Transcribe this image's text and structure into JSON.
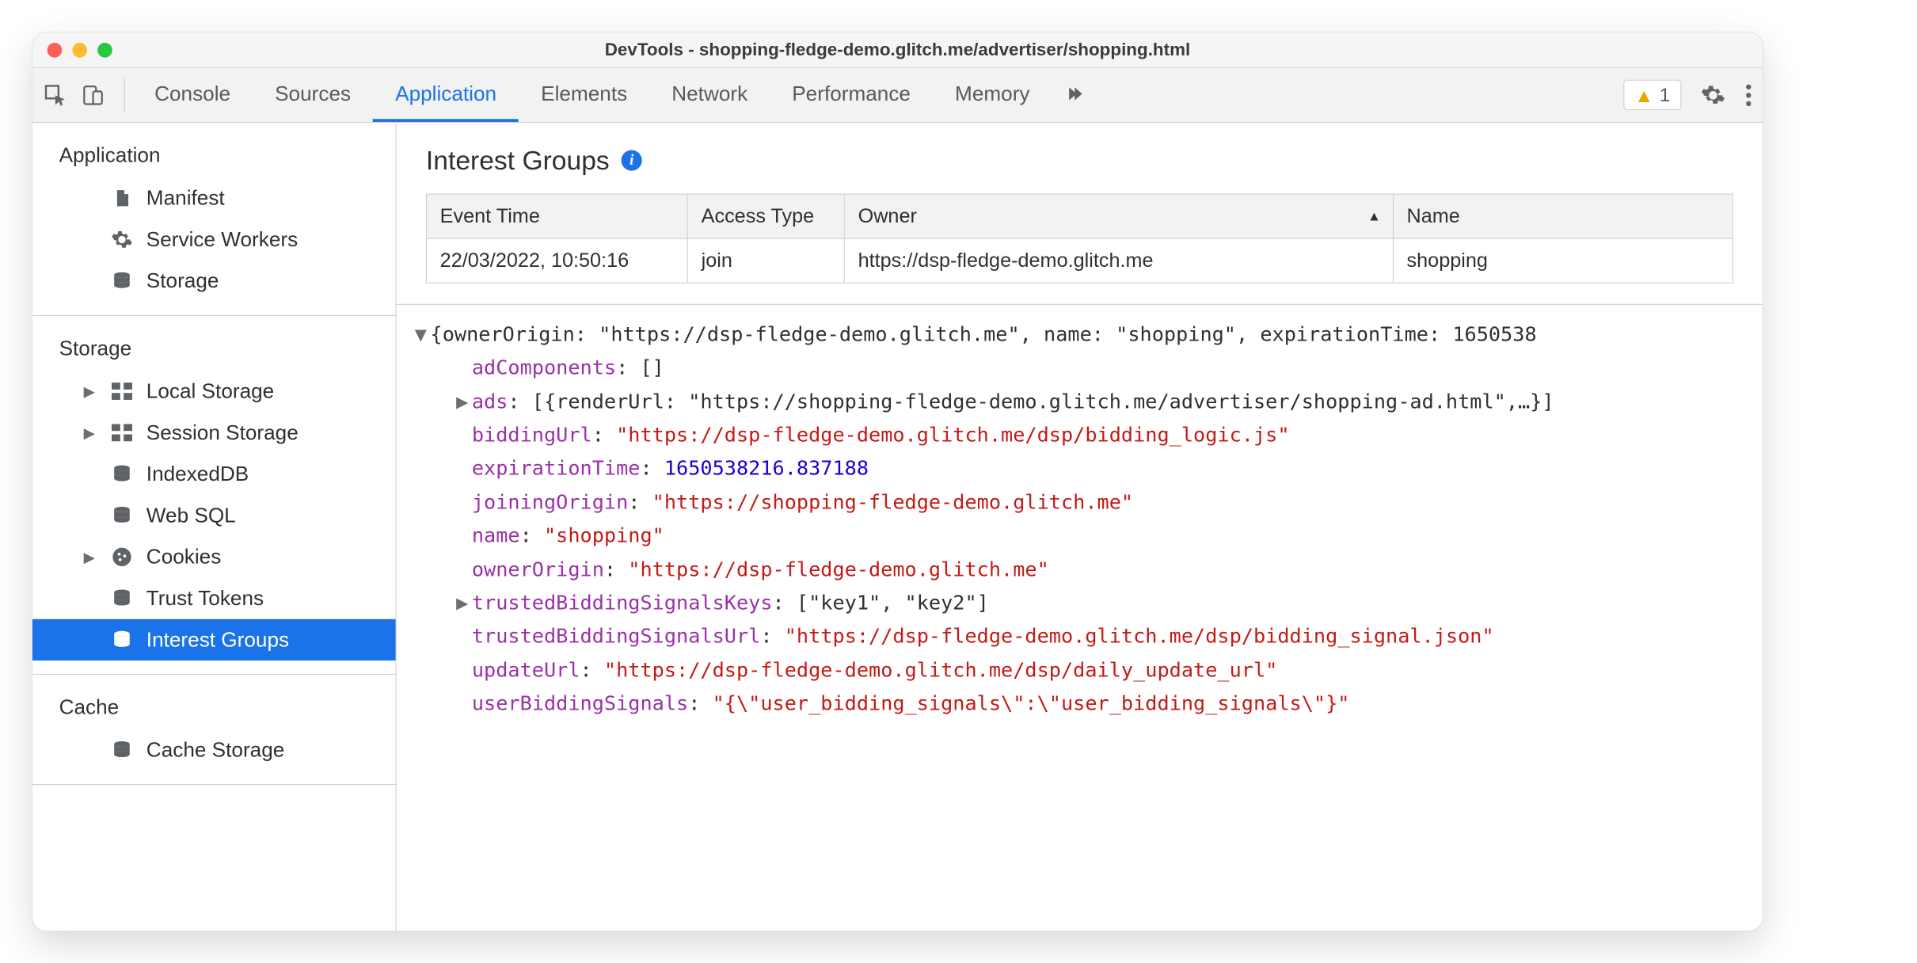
{
  "window": {
    "title": "DevTools - shopping-fledge-demo.glitch.me/advertiser/shopping.html"
  },
  "toolbar": {
    "tabs": [
      "Console",
      "Sources",
      "Application",
      "Elements",
      "Network",
      "Performance",
      "Memory"
    ],
    "active_tab_index": 2,
    "warning_count": "1"
  },
  "sidebar": {
    "sections": [
      {
        "title": "Application",
        "items": [
          {
            "label": "Manifest",
            "icon": "doc",
            "expandable": false
          },
          {
            "label": "Service Workers",
            "icon": "gear",
            "expandable": false
          },
          {
            "label": "Storage",
            "icon": "db",
            "expandable": false
          }
        ]
      },
      {
        "title": "Storage",
        "items": [
          {
            "label": "Local Storage",
            "icon": "grid",
            "expandable": true
          },
          {
            "label": "Session Storage",
            "icon": "grid",
            "expandable": true
          },
          {
            "label": "IndexedDB",
            "icon": "db",
            "expandable": false
          },
          {
            "label": "Web SQL",
            "icon": "db",
            "expandable": false
          },
          {
            "label": "Cookies",
            "icon": "cookie",
            "expandable": true
          },
          {
            "label": "Trust Tokens",
            "icon": "db",
            "expandable": false
          },
          {
            "label": "Interest Groups",
            "icon": "db",
            "expandable": false,
            "selected": true
          }
        ]
      },
      {
        "title": "Cache",
        "items": [
          {
            "label": "Cache Storage",
            "icon": "db",
            "expandable": false
          }
        ]
      }
    ]
  },
  "main": {
    "heading": "Interest Groups",
    "table": {
      "headers": [
        "Event Time",
        "Access Type",
        "Owner",
        "Name"
      ],
      "sort_col_index": 2,
      "rows": [
        [
          "22/03/2022, 10:50:16",
          "join",
          "https://dsp-fledge-demo.glitch.me",
          "shopping"
        ]
      ]
    },
    "details": {
      "summary": "{ownerOrigin: \"https://dsp-fledge-demo.glitch.me\", name: \"shopping\", expirationTime: 1650538",
      "adComponents_key": "adComponents",
      "adComponents_val": "[]",
      "ads_key": "ads",
      "ads_val": "[{renderUrl: \"https://shopping-fledge-demo.glitch.me/advertiser/shopping-ad.html\",…}]",
      "biddingUrl_key": "biddingUrl",
      "biddingUrl_val": "\"https://dsp-fledge-demo.glitch.me/dsp/bidding_logic.js\"",
      "expirationTime_key": "expirationTime",
      "expirationTime_val": "1650538216.837188",
      "joiningOrigin_key": "joiningOrigin",
      "joiningOrigin_val": "\"https://shopping-fledge-demo.glitch.me\"",
      "name_key": "name",
      "name_val": "\"shopping\"",
      "ownerOrigin_key": "ownerOrigin",
      "ownerOrigin_val": "\"https://dsp-fledge-demo.glitch.me\"",
      "tbsk_key": "trustedBiddingSignalsKeys",
      "tbsk_val": "[\"key1\", \"key2\"]",
      "tbsu_key": "trustedBiddingSignalsUrl",
      "tbsu_val": "\"https://dsp-fledge-demo.glitch.me/dsp/bidding_signal.json\"",
      "updateUrl_key": "updateUrl",
      "updateUrl_val": "\"https://dsp-fledge-demo.glitch.me/dsp/daily_update_url\"",
      "userBiddingSignals_key": "userBiddingSignals",
      "userBiddingSignals_val": "\"{\\\"user_bidding_signals\\\":\\\"user_bidding_signals\\\"}\""
    }
  }
}
